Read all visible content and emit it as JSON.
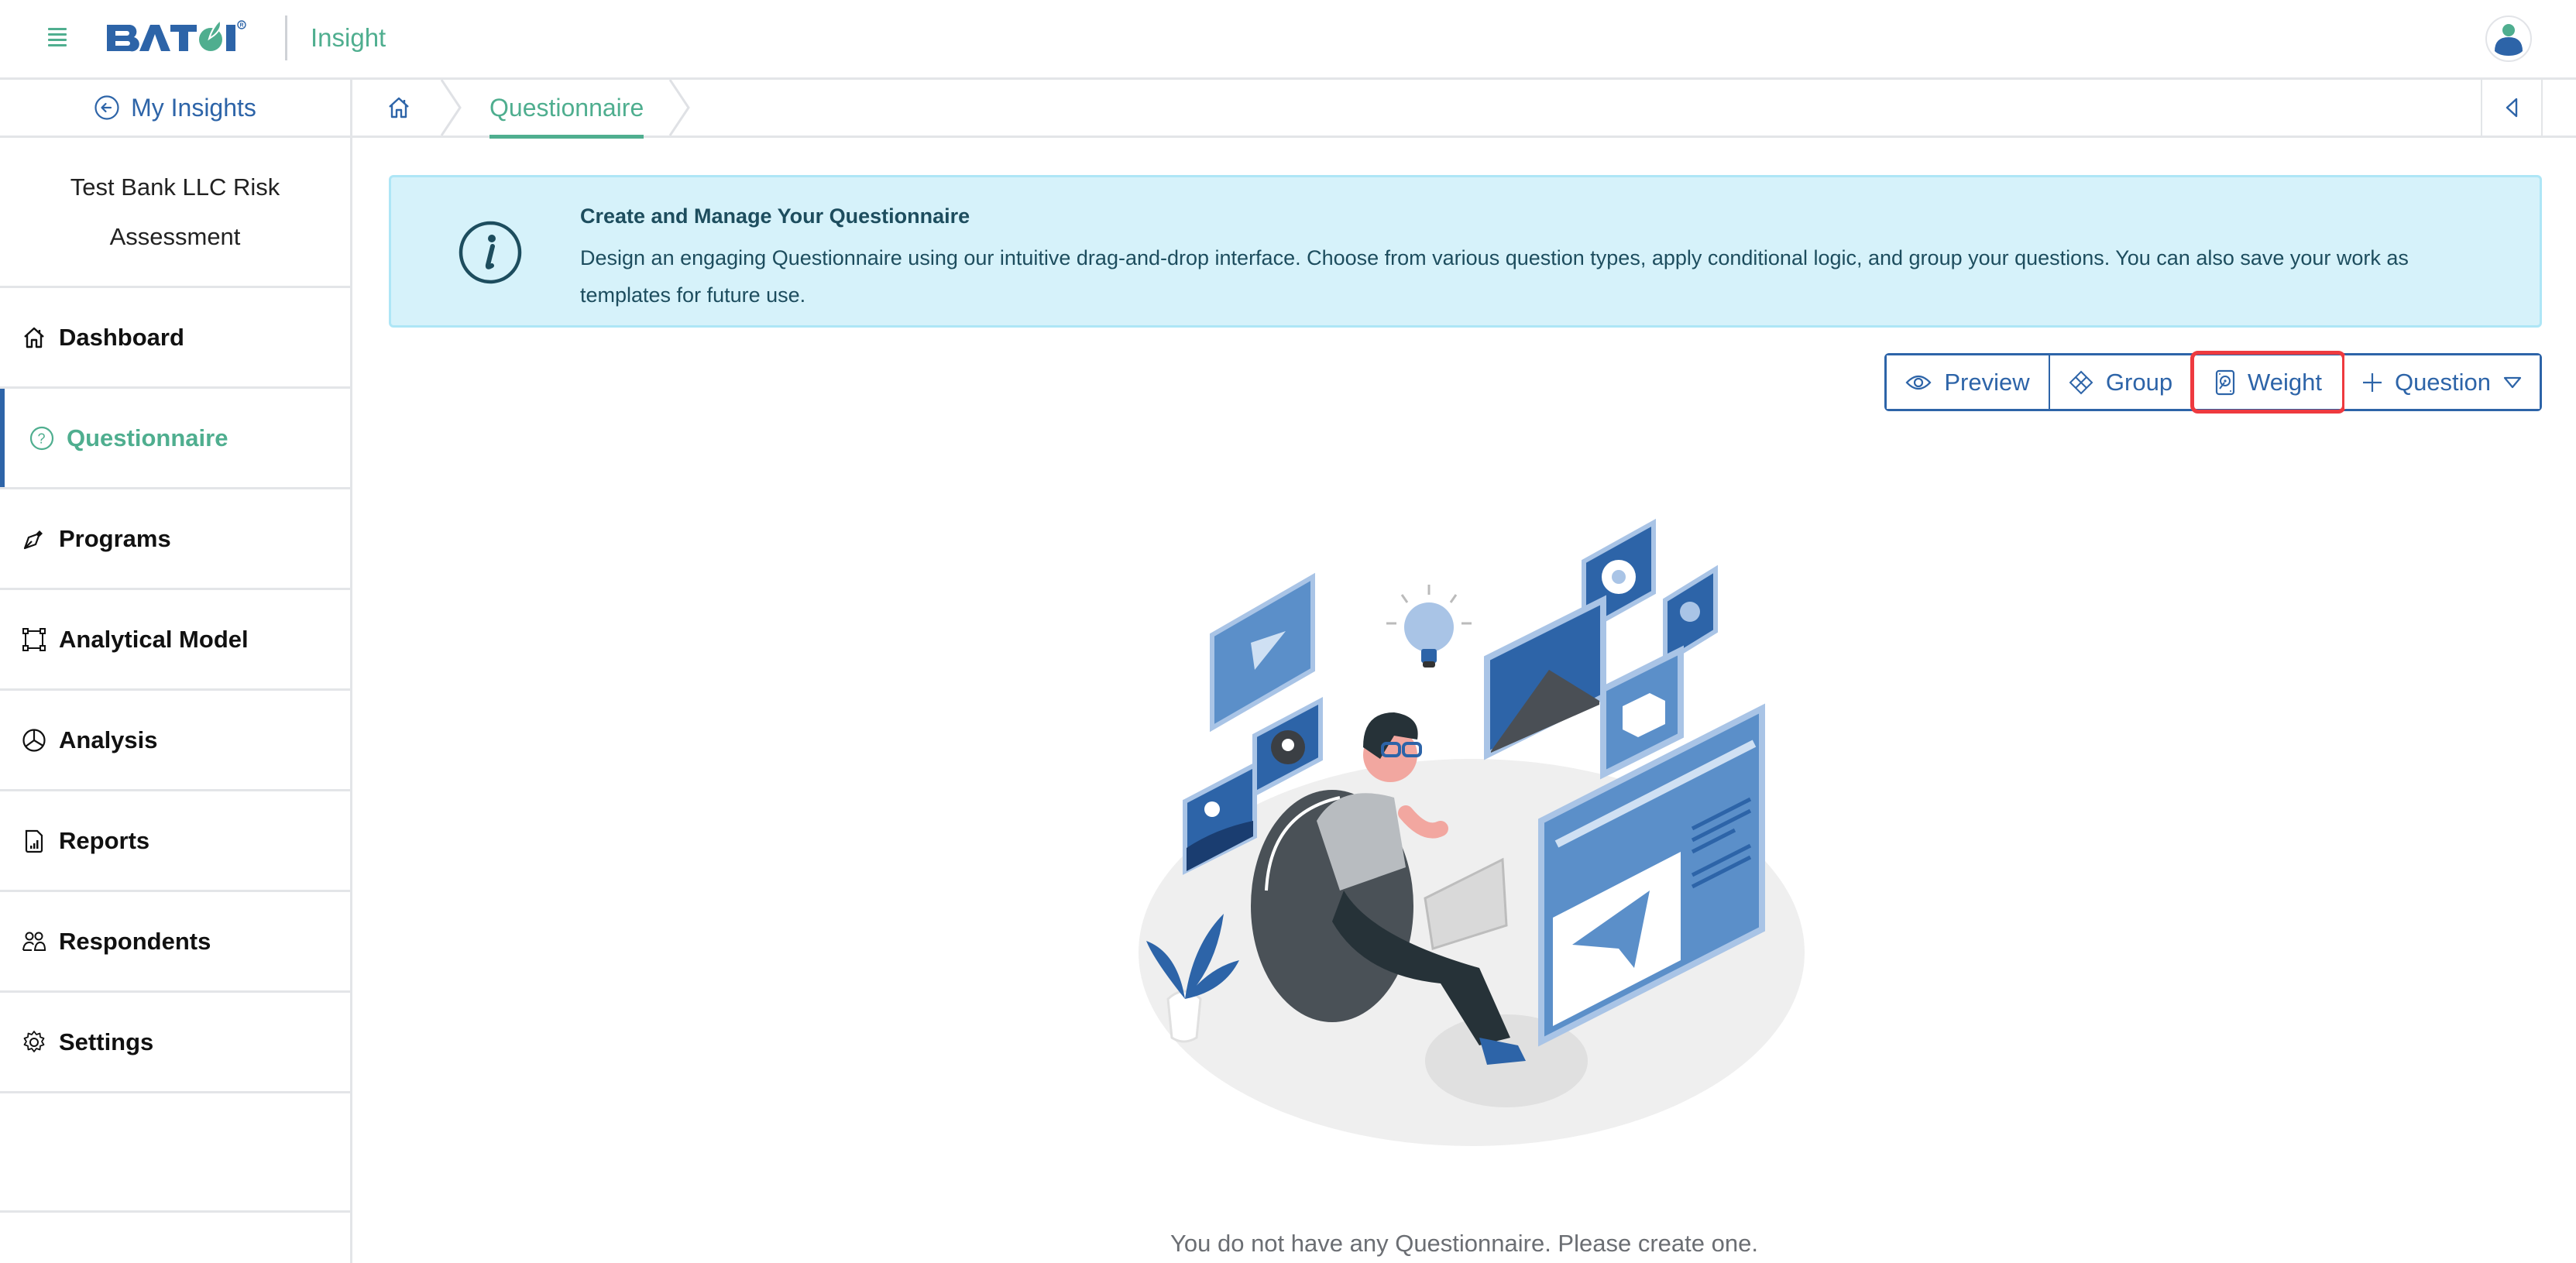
{
  "header": {
    "menu_icon": "hamburger-icon",
    "brand": "BATOI",
    "app_name": "Insight",
    "avatar_icon": "user-avatar-icon"
  },
  "sidebar": {
    "back_link": {
      "label": "My Insights",
      "icon": "arrow-left-circle-icon"
    },
    "project_title": "Test Bank LLC Risk Assessment",
    "items": [
      {
        "label": "Dashboard",
        "icon": "home-icon",
        "active": false
      },
      {
        "label": "Questionnaire",
        "icon": "question-circle-icon",
        "active": true
      },
      {
        "label": "Programs",
        "icon": "pen-nib-icon",
        "active": false
      },
      {
        "label": "Analytical Model",
        "icon": "bounding-box-icon",
        "active": false
      },
      {
        "label": "Analysis",
        "icon": "pie-chart-icon",
        "active": false
      },
      {
        "label": "Reports",
        "icon": "file-bar-chart-icon",
        "active": false
      },
      {
        "label": "Respondents",
        "icon": "people-icon",
        "active": false
      },
      {
        "label": "Settings",
        "icon": "gear-icon",
        "active": false
      }
    ]
  },
  "breadcrumb": {
    "home_icon": "home-icon",
    "items": [
      "Questionnaire"
    ],
    "collapse_icon": "triangle-left-icon"
  },
  "banner": {
    "icon": "info-circle-icon",
    "title": "Create and Manage Your Questionnaire",
    "text": "Design an engaging Questionnaire using our intuitive drag-and-drop interface. Choose from various question types, apply conditional logic, and group your questions. You can also save your work as templates for future use."
  },
  "toolbar": {
    "preview": {
      "label": "Preview",
      "icon": "eye-icon"
    },
    "group": {
      "label": "Group",
      "icon": "diamond-grid-icon"
    },
    "weight": {
      "label": "Weight",
      "icon": "hard-drive-icon",
      "highlighted": true
    },
    "question": {
      "label": "Question",
      "icon": "plus-icon",
      "dropdown_icon": "triangle-down-icon"
    }
  },
  "empty_state": {
    "illustration": "person-on-beanbag-with-laptop-illustration",
    "message": "You do not have any Questionnaire. Please create one."
  },
  "colors": {
    "brand_blue": "#2d64a8",
    "brand_green": "#4fae8f",
    "banner_bg": "#d6f2fa",
    "banner_border": "#aee6f6",
    "highlight_red": "#ee3a3f"
  }
}
